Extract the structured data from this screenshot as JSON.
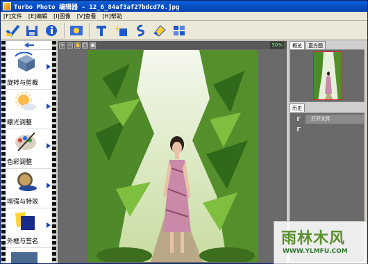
{
  "window": {
    "title": "Turbo Photo 编辑器  - 12_6_84af3af27bdcd76.jpg"
  },
  "menu": [
    "[F]文件",
    "[E]编辑",
    "[I]图像",
    "[V]查看",
    "[H]帮助"
  ],
  "toolbar": {
    "buttons": [
      "open-check-icon",
      "save-icon",
      "info-icon",
      "capture-icon",
      "text-icon",
      "sparkle-icon",
      "brush-icon",
      "eraser-icon",
      "grid-icon"
    ]
  },
  "left_panel": {
    "tools": [
      {
        "label": "旋转与剪裁",
        "icon": "rotate-crop-icon"
      },
      {
        "label": "曝光调整",
        "icon": "exposure-icon"
      },
      {
        "label": "色彩调整",
        "icon": "color-palette-icon"
      },
      {
        "label": "增强与特效",
        "icon": "enhance-icon"
      },
      {
        "label": "外框与签名",
        "icon": "frame-sign-icon"
      }
    ]
  },
  "canvas": {
    "zoom": "50%"
  },
  "right_panel": {
    "tabs": [
      "概览",
      "直方图"
    ],
    "history_tab": "历史",
    "history_items": [
      "打开文件"
    ]
  },
  "watermark": {
    "brand": "雨林木风",
    "url": "WWW.YLMFU.COM"
  },
  "colors": {
    "title_bar": "#0a5fd8",
    "panel_bg": "#6a6a6a",
    "film": "#111111"
  }
}
